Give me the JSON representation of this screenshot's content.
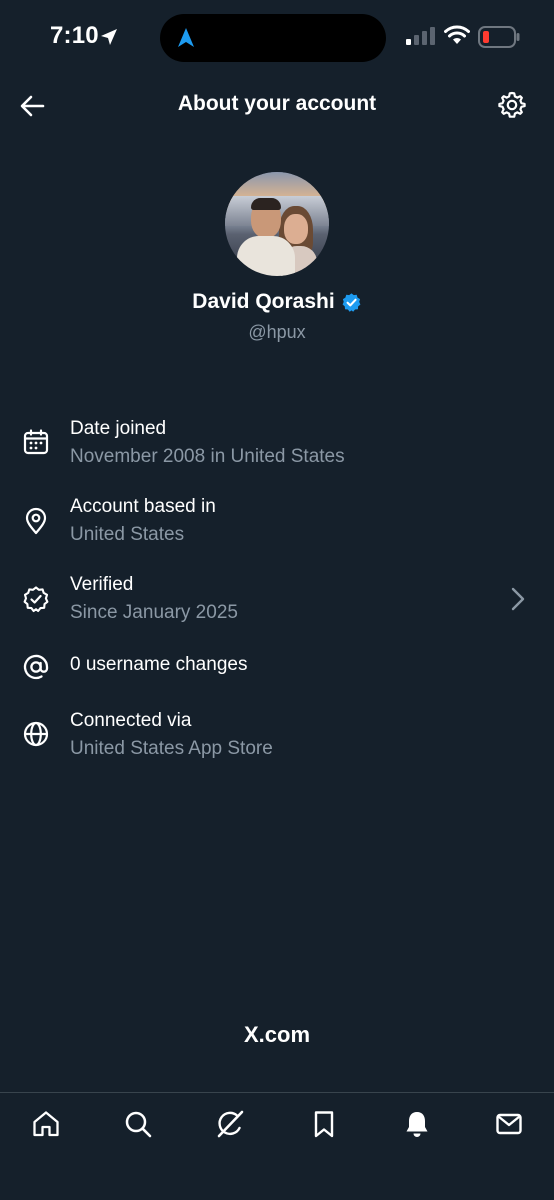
{
  "status_bar": {
    "time": "7:10"
  },
  "header": {
    "title": "About your account",
    "back_icon": "arrow-left-icon",
    "settings_icon": "gear-icon"
  },
  "profile": {
    "name": "David Qorashi",
    "handle": "@hpux",
    "verified": true
  },
  "info_rows": [
    {
      "icon": "calendar-icon",
      "title": "Date joined",
      "subtitle": "November 2008 in United States"
    },
    {
      "icon": "location-pin-icon",
      "title": "Account based in",
      "subtitle": "United States"
    },
    {
      "icon": "verified-badge-icon",
      "title": "Verified",
      "subtitle": "Since January 2025"
    },
    {
      "icon": "at-sign-icon",
      "title": "0 username changes",
      "subtitle": ""
    },
    {
      "icon": "globe-icon",
      "title": "Connected via",
      "subtitle": "United States App Store"
    }
  ],
  "footer": {
    "brand": "X",
    "brand_suffix": ".com"
  },
  "tab_bar": [
    "home-icon",
    "search-icon",
    "grok-icon",
    "bookmark-icon",
    "notifications-icon",
    "messages-icon"
  ],
  "colors": {
    "background": "#15202b",
    "secondary_text": "#8b98a5",
    "verified_blue": "#1d9bf0",
    "divider": "#38444d"
  }
}
